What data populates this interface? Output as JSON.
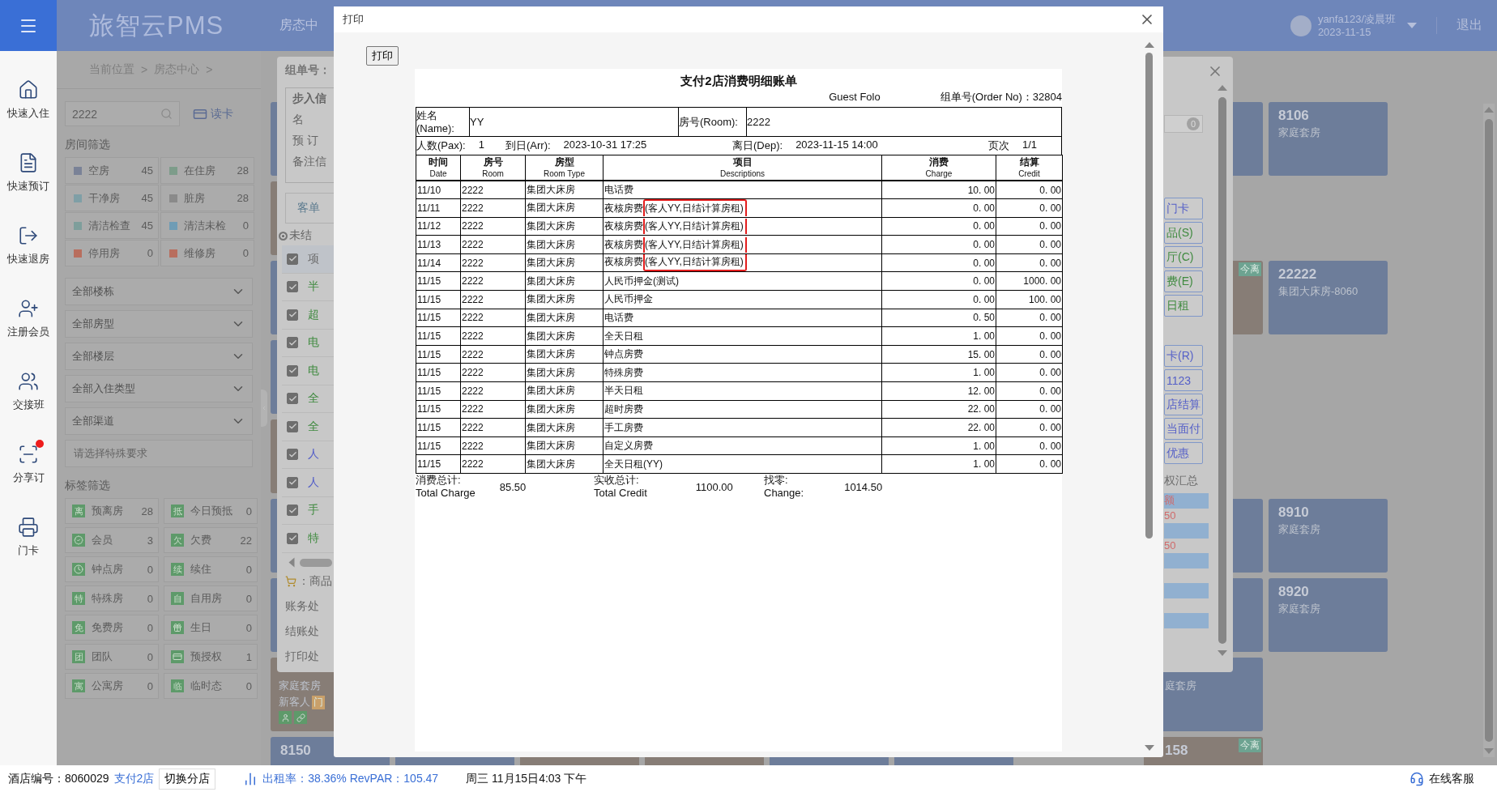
{
  "topbar": {
    "logo": "旅智云PMS",
    "nav_item": "房态中",
    "user": {
      "name": "yanfa123/凌晨班",
      "date": "2023-11-15"
    },
    "logout": "退出"
  },
  "left_nav": [
    {
      "label": "快速入住",
      "notification": false
    },
    {
      "label": "快速预订",
      "notification": false
    },
    {
      "label": "快速退房",
      "notification": false
    },
    {
      "label": "注册会员",
      "notification": false
    },
    {
      "label": "交接班",
      "notification": false
    },
    {
      "label": "分享订",
      "notification": true
    },
    {
      "label": "门卡",
      "notification": false
    }
  ],
  "breadcrumb": [
    "当前位置",
    ">",
    "房态中心",
    ">"
  ],
  "filter": {
    "search": "2222",
    "read_card": "读卡",
    "room_title": "房间筛选",
    "room_status": [
      {
        "label": "空房",
        "count": "45",
        "color": "#7a8297"
      },
      {
        "label": "在住房",
        "count": "28",
        "color": "#7d9c8a"
      },
      {
        "label": "干净房",
        "count": "45",
        "color": "#7f9fa6"
      },
      {
        "label": "脏房",
        "count": "28",
        "color": "#8a8a8a"
      },
      {
        "label": "清洁检查",
        "count": "45",
        "color": "#7e9e9b"
      },
      {
        "label": "清洁未检",
        "count": "0",
        "color": "#6f9cb5"
      },
      {
        "label": "停用房",
        "count": "0",
        "color": "#b86e5e"
      },
      {
        "label": "维修房",
        "count": "0",
        "color": "#b86e5e"
      }
    ],
    "dropdowns": [
      "全部楼栋",
      "全部房型",
      "全部楼层",
      "全部入住类型",
      "全部渠道"
    ],
    "special_placeholder": "请选择特殊要求",
    "tag_title": "标签筛选",
    "tags": [
      {
        "badge": "离",
        "label": "预离房",
        "count": "28"
      },
      {
        "badge": "抵",
        "label": "今日预抵",
        "count": "0"
      },
      {
        "label": "会员",
        "count": "3"
      },
      {
        "badge": "欠",
        "label": "欠费",
        "count": "22"
      },
      {
        "label": "钟点房",
        "count": "0"
      },
      {
        "badge": "续",
        "label": "续住",
        "count": "0"
      },
      {
        "badge": "特",
        "label": "特殊房",
        "count": "0"
      },
      {
        "badge": "自",
        "label": "自用房",
        "count": "0"
      },
      {
        "badge": "免",
        "label": "免费房",
        "count": "0"
      },
      {
        "label": "生日",
        "count": "0"
      },
      {
        "badge": "团",
        "label": "团队",
        "count": "0"
      },
      {
        "label": "预授权",
        "count": "1"
      },
      {
        "badge": "寓",
        "label": "公寓房",
        "count": "0"
      },
      {
        "badge": "临",
        "label": "临时态",
        "count": "0"
      }
    ]
  },
  "tiles": [
    {
      "kind": "vacant",
      "number": "8106",
      "type": "家庭套房"
    },
    {
      "kind": "vacant",
      "number": "22222",
      "type": "集团大床房-8060"
    },
    {
      "kind": "vacant",
      "number": "8910",
      "type": "家庭套房"
    },
    {
      "kind": "vacant",
      "number": "8920",
      "type": "家庭套房"
    },
    {
      "kind": "vacant"
    },
    {
      "kind": "occupied",
      "tag": "今离"
    },
    {
      "kind": "vacant"
    },
    {
      "kind": "vacant"
    },
    {
      "kind": "vacant",
      "type": "庭套房"
    },
    {
      "kind": "occupied",
      "number": "158",
      "tag": "今离"
    },
    {
      "kind": "occupied",
      "type": "家庭套房",
      "guest": "新客人",
      "tag": "门"
    },
    {
      "kind": "vacant",
      "number": "8150"
    },
    {
      "kind": "vacant"
    },
    {
      "kind": "occupied"
    },
    {
      "kind": "vacant"
    },
    {
      "kind": "vacant"
    },
    {
      "kind": "occupied"
    },
    {
      "kind": "vacant"
    },
    {
      "kind": "vacant"
    },
    {
      "kind": "vacant"
    },
    {
      "kind": "occupied"
    },
    {
      "kind": "occupied"
    },
    {
      "kind": "vacant"
    },
    {
      "kind": "vacant"
    }
  ],
  "group_dialog": {
    "title": "组单号：",
    "fieldset": "步入信",
    "fields": [
      "名",
      "预 订",
      "备注信"
    ],
    "tab": "客单",
    "radio": {
      "label": "未结",
      "selected": true
    },
    "items": [
      {
        "text": "项",
        "kind": "header",
        "checked": true
      },
      {
        "text": "半",
        "kind": "room",
        "checked": true
      },
      {
        "text": "超",
        "kind": "room",
        "checked": true
      },
      {
        "text": "电",
        "kind": "room",
        "checked": true
      },
      {
        "text": "电",
        "kind": "room",
        "checked": true
      },
      {
        "text": "全",
        "kind": "room",
        "checked": true
      },
      {
        "text": "全",
        "kind": "room",
        "checked": true
      },
      {
        "text": "人",
        "kind": "deposit",
        "checked": true
      },
      {
        "text": "人",
        "kind": "deposit",
        "checked": true
      },
      {
        "text": "手",
        "kind": "room",
        "checked": true
      },
      {
        "text": "特",
        "kind": "room",
        "checked": true
      }
    ],
    "goods": "：商品",
    "actions": [
      "账务处",
      "结账处",
      "打印处"
    ],
    "badge": "0",
    "buttons": [
      {
        "text": "门卡",
        "kind": "blue"
      },
      {
        "text": "品(S)",
        "kind": "green"
      },
      {
        "text": "厅(C)",
        "kind": "green"
      },
      {
        "text": "费(E)",
        "kind": "green"
      },
      {
        "text": "日租",
        "kind": "green"
      },
      {
        "text": "卡(R)",
        "kind": "blue"
      },
      {
        "text": "1123",
        "kind": "blue"
      },
      {
        "text": "店结算",
        "kind": "blue"
      },
      {
        "text": "当面付",
        "kind": "blue"
      },
      {
        "text": "优惠",
        "kind": "blue"
      }
    ],
    "summary_title": "权汇总",
    "summary": [
      "额",
      "50",
      "50"
    ]
  },
  "print_dialog": {
    "title": "打印",
    "print_button": "打印",
    "document": {
      "title": "支付2店消费明细账单",
      "subtitle": "Guest Folo",
      "order": "组单号(Order No)：32804",
      "name_label": [
        "姓名",
        "(Name):"
      ],
      "name": "YY",
      "room_label": "房号(Room):",
      "room": "2222",
      "info": [
        {
          "label": "人数(Pax):",
          "value": "1"
        },
        {
          "label": "到日(Arr):",
          "value": "2023-10-31 17:25"
        },
        {
          "label": "离日(Dep):",
          "value": "2023-11-15 14:00"
        },
        {
          "label": "页次",
          "value": "1/1"
        }
      ],
      "columns": [
        {
          "zh": "时间",
          "en": "Date"
        },
        {
          "zh": "房号",
          "en": "Room"
        },
        {
          "zh": "房型",
          "en": "Room Type"
        },
        {
          "zh": "项目",
          "en": "Descriptions"
        },
        {
          "zh": "消费",
          "en": "Charge"
        },
        {
          "zh": "结算",
          "en": "Credit"
        }
      ],
      "rows": [
        {
          "date": "11/10",
          "room": "2222",
          "type": "集团大床房",
          "desc": "电话费",
          "charge": "10. 00",
          "credit": "0. 00",
          "highlighted": false
        },
        {
          "date": "11/11",
          "room": "2222",
          "type": "集团大床房",
          "desc": "夜核房费",
          "note": "(客人YY,日结计算房租)",
          "charge": "0. 00",
          "credit": "0. 00",
          "highlighted": true
        },
        {
          "date": "11/12",
          "room": "2222",
          "type": "集团大床房",
          "desc": "夜核房费",
          "note": "(客人YY,日结计算房租)",
          "charge": "0. 00",
          "credit": "0. 00",
          "highlighted": true
        },
        {
          "date": "11/13",
          "room": "2222",
          "type": "集团大床房",
          "desc": "夜核房费",
          "note": "(客人YY,日结计算房租)",
          "charge": "0. 00",
          "credit": "0. 00",
          "highlighted": true
        },
        {
          "date": "11/14",
          "room": "2222",
          "type": "集团大床房",
          "desc": "夜核房费",
          "note": "(客人YY,日结计算房租)",
          "charge": "0. 00",
          "credit": "0. 00",
          "highlighted": true
        },
        {
          "date": "11/15",
          "room": "2222",
          "type": "集团大床房",
          "desc": "人民币押金(测试)",
          "charge": "0. 00",
          "credit": "1000. 00",
          "highlighted": false
        },
        {
          "date": "11/15",
          "room": "2222",
          "type": "集团大床房",
          "desc": "人民币押金",
          "charge": "0. 00",
          "credit": "100. 00",
          "highlighted": false
        },
        {
          "date": "11/15",
          "room": "2222",
          "type": "集团大床房",
          "desc": "电话费",
          "charge": "0. 50",
          "credit": "0. 00",
          "highlighted": false
        },
        {
          "date": "11/15",
          "room": "2222",
          "type": "集团大床房",
          "desc": "全天日租",
          "charge": "1. 00",
          "credit": "0. 00",
          "highlighted": false
        },
        {
          "date": "11/15",
          "room": "2222",
          "type": "集团大床房",
          "desc": "钟点房费",
          "charge": "15. 00",
          "credit": "0. 00",
          "highlighted": false
        },
        {
          "date": "11/15",
          "room": "2222",
          "type": "集团大床房",
          "desc": "特殊房费",
          "charge": "1. 00",
          "credit": "0. 00",
          "highlighted": false
        },
        {
          "date": "11/15",
          "room": "2222",
          "type": "集团大床房",
          "desc": "半天日租",
          "charge": "12. 00",
          "credit": "0. 00",
          "highlighted": false
        },
        {
          "date": "11/15",
          "room": "2222",
          "type": "集团大床房",
          "desc": "超时房费",
          "charge": "22. 00",
          "credit": "0. 00",
          "highlighted": false
        },
        {
          "date": "11/15",
          "room": "2222",
          "type": "集团大床房",
          "desc": "手工房费",
          "charge": "22. 00",
          "credit": "0. 00",
          "highlighted": false
        },
        {
          "date": "11/15",
          "room": "2222",
          "type": "集团大床房",
          "desc": "自定义房费",
          "charge": "1. 00",
          "credit": "0. 00",
          "highlighted": false
        },
        {
          "date": "11/15",
          "room": "2222",
          "type": "集团大床房",
          "desc": "全天日租(YY)",
          "charge": "1. 00",
          "credit": "0. 00",
          "highlighted": false
        }
      ],
      "totals": [
        {
          "zh": "消费总计:",
          "en": "Total Charge",
          "value": "85.50"
        },
        {
          "zh": "实收总计:",
          "en": "Total Credit",
          "value": "1100.00"
        },
        {
          "zh": "找零:",
          "en": "Change:",
          "value": "1014.50"
        }
      ]
    }
  },
  "status_bar": {
    "hotel_label": "酒店编号：8060029",
    "store": "支付2店",
    "switch": "切换分店",
    "stats": "出租率：38.36% RevPAR：105.47",
    "datetime": "周三 11月15日4:03 下午",
    "support": "在线客服"
  }
}
